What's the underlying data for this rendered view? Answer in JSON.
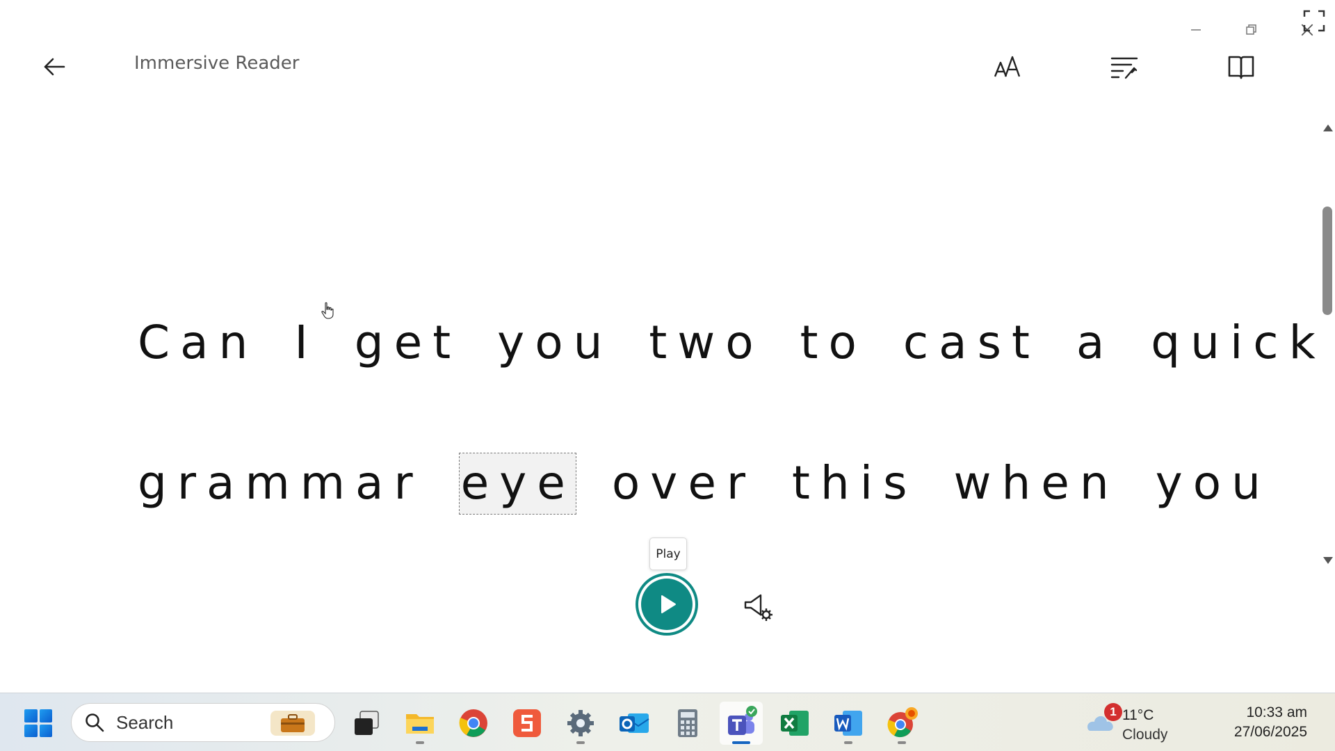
{
  "header": {
    "title": "Immersive Reader",
    "back_icon": "arrow-left-icon",
    "tools": [
      "text-preferences-icon",
      "grammar-options-icon",
      "reading-preferences-icon"
    ]
  },
  "window_controls": [
    "minimize-icon",
    "restore-icon",
    "close-icon",
    "fullscreen-icon"
  ],
  "reader": {
    "line1": "Can I get you two to cast a quick",
    "line2_before": "grammar",
    "line2_highlight": "eye",
    "line2_after": "over this when you"
  },
  "player": {
    "tooltip": "Play",
    "accent_color": "#0f8a84"
  },
  "taskbar": {
    "search_placeholder": "Search",
    "apps": [
      "File Explorer Tasks",
      "File Explorer",
      "Google Chrome",
      "Sumo",
      "Settings",
      "Outlook",
      "Calculator",
      "Microsoft Teams",
      "Excel",
      "Word",
      "Chrome Canary"
    ],
    "weather": {
      "badge": "1",
      "temp": "11°C",
      "condition": "Cloudy"
    },
    "clock": {
      "time": "10:33 am",
      "date": "27/06/2025"
    }
  }
}
